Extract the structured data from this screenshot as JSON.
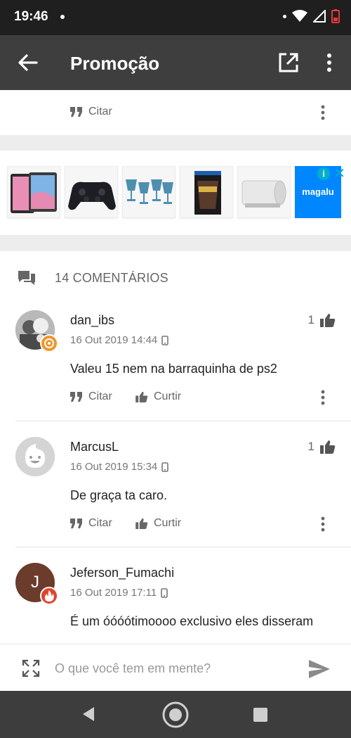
{
  "status_bar": {
    "time": "19:46"
  },
  "app_bar": {
    "title": "Promoção"
  },
  "top_card": {
    "quote_label": "Citar"
  },
  "ad": {
    "brand_label": "magalu",
    "info_label": "i",
    "close_label": "✕",
    "products": [
      "tablet-icon",
      "gamepad-icon",
      "glasses-icon",
      "game-box-icon",
      "film-roll-icon"
    ]
  },
  "comments_section": {
    "count_label": "14 COMENTÁRIOS",
    "items": [
      {
        "name": "dan_ibs",
        "date": "16 Out 2019 14:44",
        "likes": "1",
        "text": "Valeu 15 nem na barraquinha de ps2",
        "quote_label": "Citar",
        "like_label": "Curtir",
        "avatar": "photo-avatar",
        "badge_color": "#f0952a"
      },
      {
        "name": "MarcusL",
        "date": "16 Out 2019 15:34",
        "likes": "1",
        "text": "De graça ta caro.",
        "quote_label": "Citar",
        "like_label": "Curtir",
        "avatar": "smiley-avatar"
      },
      {
        "name": "Jeferson_Fumachi",
        "date": "16 Out 2019 17:11",
        "text": "É um óóóótimoooo exclusivo eles disseram",
        "avatar_letter": "J",
        "avatar_color": "#6b3b2c",
        "badge_color": "#e0452b"
      }
    ]
  },
  "input_bar": {
    "placeholder": "O que você tem em mente?"
  },
  "colors": {
    "app_bar": "#3e3e3e",
    "status_bar": "#1f1f1f",
    "ad_accent": "#00aecd",
    "magalu_blue": "#0086ff"
  }
}
